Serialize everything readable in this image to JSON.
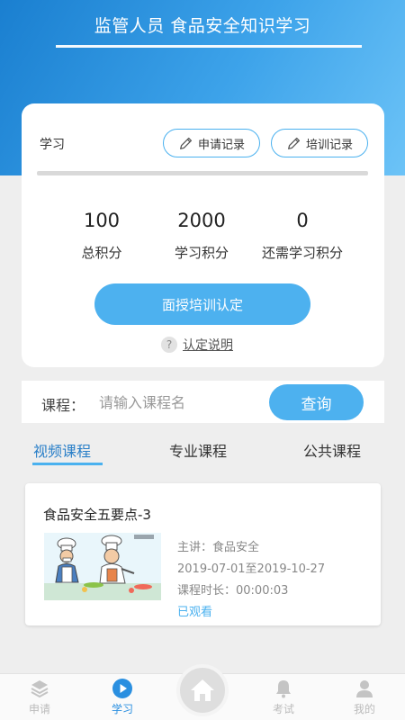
{
  "header": {
    "title": "监管人员 食品安全知识学习"
  },
  "study_card": {
    "label": "学习",
    "apply_record_label": "申请记录",
    "training_record_label": "培训记录",
    "progress_fraction": 0,
    "stats": [
      {
        "value": "100",
        "label": "总积分"
      },
      {
        "value": "2000",
        "label": "学习积分"
      },
      {
        "value": "0",
        "label": "还需学习积分"
      }
    ],
    "certify_button": "面授培训认定",
    "explain_link": "认定说明",
    "explain_icon": "?"
  },
  "search": {
    "label": "课程：",
    "placeholder": "请输入课程名",
    "value": "",
    "button": "查询"
  },
  "tabs": [
    {
      "label": "视频课程",
      "active": true
    },
    {
      "label": "专业课程",
      "active": false
    },
    {
      "label": "公共课程",
      "active": false
    }
  ],
  "course": {
    "title": "食品安全五要点-3",
    "lecturer": "主讲：食品安全",
    "date_range": "2019-07-01至2019-10-27",
    "duration": "课程时长：00:00:03",
    "status": "已观看"
  },
  "bottom_nav": {
    "items": [
      {
        "label": "申请",
        "icon": "layers-icon",
        "active": false
      },
      {
        "label": "学习",
        "icon": "play-icon",
        "active": true
      },
      {
        "label": "",
        "icon": "home-icon",
        "active": false
      },
      {
        "label": "考试",
        "icon": "bell-icon",
        "active": false
      },
      {
        "label": "我的",
        "icon": "person-icon",
        "active": false
      }
    ]
  },
  "colors": {
    "header_start": "#1a7fd0",
    "header_end": "#6cc3f7",
    "accent": "#4db1ef",
    "active_tab": "#2a7fc8",
    "nav_inactive": "#bbbbbb"
  }
}
